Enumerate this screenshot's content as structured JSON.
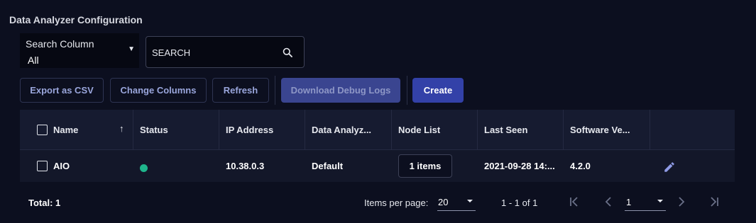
{
  "page": {
    "title": "Data Analyzer Configuration"
  },
  "search": {
    "column_label": "Search Column",
    "column_value": "All",
    "placeholder": "SEARCH"
  },
  "toolbar": {
    "export_csv": "Export as CSV",
    "change_columns": "Change Columns",
    "refresh": "Refresh",
    "download_debug_logs": "Download Debug Logs",
    "create": "Create"
  },
  "table": {
    "headers": [
      "Name",
      "Status",
      "IP Address",
      "Data Analyz...",
      "Node List",
      "Last Seen",
      "Software Ve..."
    ],
    "rows": [
      {
        "name": "AIO",
        "status": "online",
        "ip_address": "10.38.0.3",
        "data_analyzer": "Default",
        "node_list": "1 items",
        "last_seen": "2021-09-28 14:...",
        "software_version": "4.2.0"
      }
    ]
  },
  "footer": {
    "total": "Total: 1",
    "items_per_page_label": "Items per page:",
    "items_per_page_value": "20",
    "range": "1 - 1 of 1",
    "current_page": "1"
  },
  "colors": {
    "background": "#0c0f1f",
    "primary": "#3341a8",
    "status_online": "#1fb58c",
    "accent_text": "#9aa6dc"
  },
  "icons": {
    "search": "search-icon",
    "dropdown": "chevron-down-icon",
    "sort": "arrow-up-icon",
    "edit": "pencil-icon",
    "first_page": "first-page-icon",
    "prev_page": "chevron-left-icon",
    "next_page": "chevron-right-icon",
    "last_page": "last-page-icon"
  }
}
